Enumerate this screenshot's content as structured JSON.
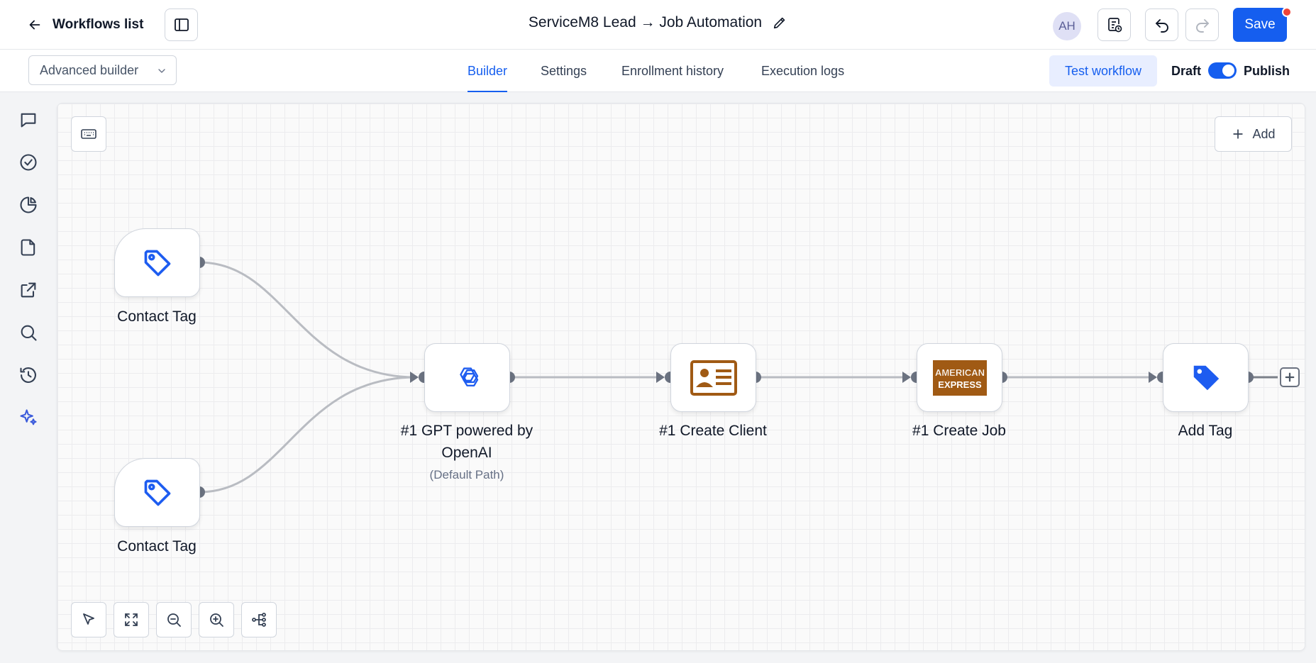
{
  "header": {
    "back_label": "Workflows list",
    "workflow_title": "ServiceM8 Lead → Job Automation",
    "avatar_initials": "AH",
    "save_label": "Save"
  },
  "subheader": {
    "builder_mode": "Advanced builder",
    "tabs": [
      {
        "label": "Builder",
        "active": true
      },
      {
        "label": "Settings",
        "active": false
      },
      {
        "label": "Enrollment history",
        "active": false
      },
      {
        "label": "Execution logs",
        "active": false
      }
    ],
    "test_label": "Test workflow",
    "draft_label": "Draft",
    "publish_label": "Publish",
    "publish_toggle_on": true
  },
  "sidebar": {
    "icons": [
      "chat-icon",
      "check-circle-icon",
      "pie-chart-icon",
      "file-icon",
      "external-link-icon",
      "search-icon",
      "history-icon",
      "sparkles-icon"
    ]
  },
  "canvas": {
    "add_label": "Add",
    "nodes": [
      {
        "id": "trigger-1",
        "label": "Contact Tag",
        "icon": "tag-outline-icon"
      },
      {
        "id": "trigger-2",
        "label": "Contact Tag",
        "icon": "tag-outline-icon"
      },
      {
        "id": "gpt",
        "label": "#1 GPT powered by OpenAI",
        "sub": "(Default Path)",
        "icon": "openai-icon"
      },
      {
        "id": "create-client",
        "label": "#1 Create Client",
        "icon": "contact-card-icon"
      },
      {
        "id": "create-job",
        "label": "#1 Create Job",
        "icon": "amex-icon",
        "icon_text": "AMERICAN EXPRESS"
      },
      {
        "id": "add-tag",
        "label": "Add Tag",
        "icon": "tag-filled-icon"
      }
    ],
    "toolbar": [
      "pointer-icon",
      "fit-view-icon",
      "zoom-out-icon",
      "zoom-in-icon",
      "auto-layout-icon"
    ]
  },
  "colors": {
    "accent": "#155eef",
    "brown_icon": "#a05a14",
    "notification": "#f04438"
  }
}
